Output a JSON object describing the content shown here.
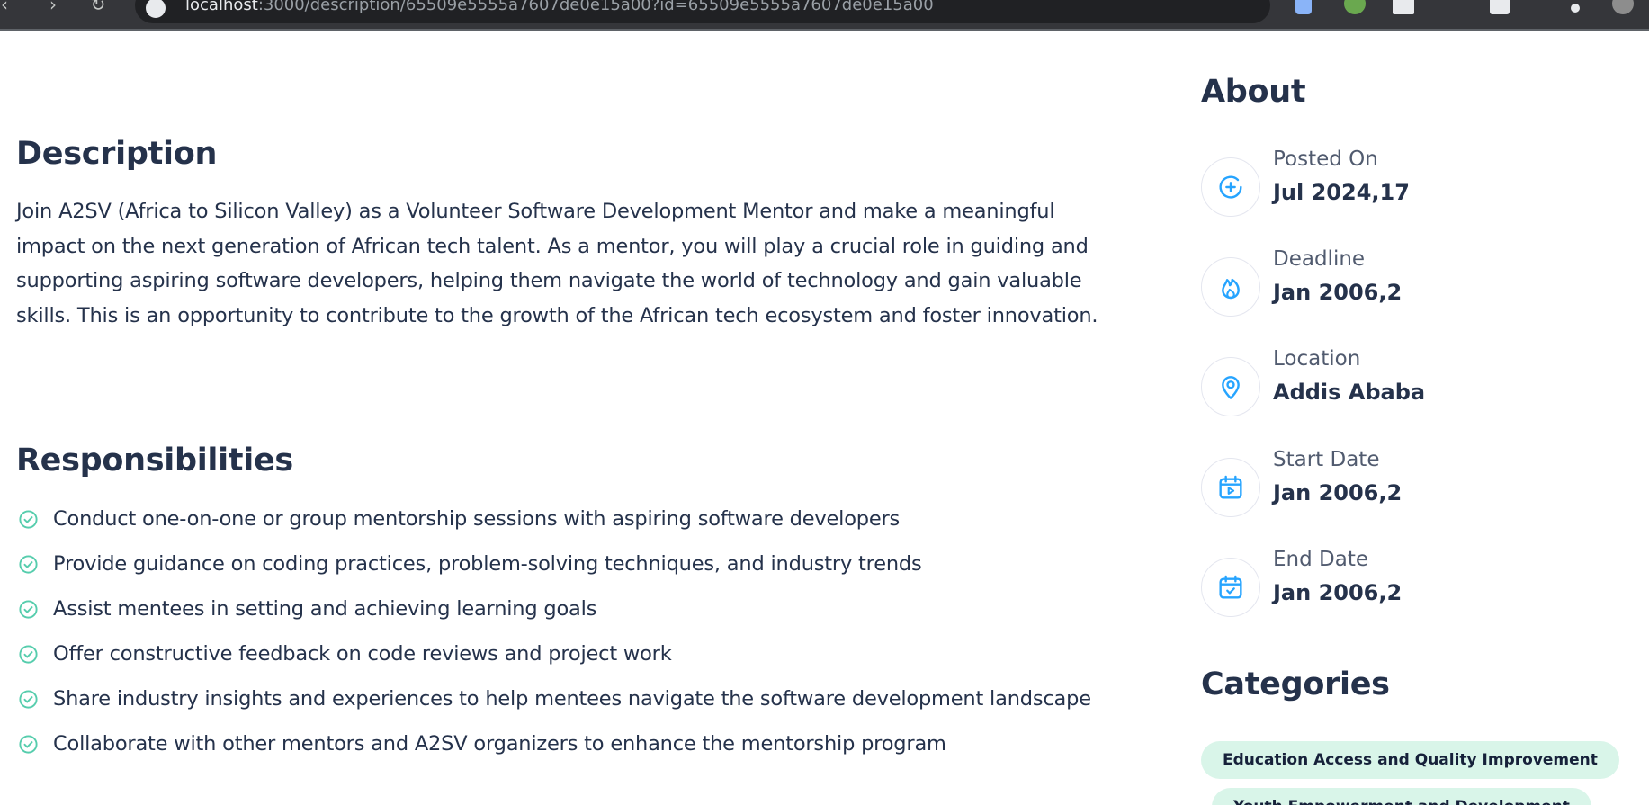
{
  "browser": {
    "url_host": "localhost",
    "url_rest": ":3000/description/65509e5555a7607de0e15a00?id=65509e5555a7607de0e15a00"
  },
  "description": {
    "title": "Description",
    "text": "Join A2SV (Africa to Silicon Valley) as a Volunteer Software Development Mentor and make a meaningful impact on the next generation of African tech talent. As a mentor, you will play a crucial role in guiding and supporting aspiring software developers, helping them navigate the world of technology and gain valuable skills. This is an opportunity to contribute to the growth of the African tech ecosystem and foster innovation."
  },
  "responsibilities": {
    "title": "Responsibilities",
    "items": [
      "Conduct one-on-one or group mentorship sessions with aspiring software developers",
      "Provide guidance on coding practices, problem-solving techniques, and industry trends",
      "Assist mentees in setting and achieving learning goals",
      "Offer constructive feedback on code reviews and project work",
      "Share industry insights and experiences to help mentees navigate the software development landscape",
      "Collaborate with other mentors and A2SV organizers to enhance the mentorship program"
    ]
  },
  "about": {
    "title": "About",
    "items": [
      {
        "label": "Posted On",
        "value": "Jul 2024,17",
        "icon": "plus-circle-icon"
      },
      {
        "label": "Deadline",
        "value": "Jan 2006,2",
        "icon": "fire-icon"
      },
      {
        "label": "Location",
        "value": "Addis Ababa",
        "icon": "map-pin-icon"
      },
      {
        "label": "Start Date",
        "value": "Jan 2006,2",
        "icon": "calendar-play-icon"
      },
      {
        "label": "End Date",
        "value": "Jan 2006,2",
        "icon": "calendar-check-icon"
      }
    ]
  },
  "categories": {
    "title": "Categories",
    "items": [
      "Education Access and Quality Improvement",
      "Youth Empowerment and Development"
    ]
  },
  "colors": {
    "heading": "#25324B",
    "accent_blue": "#26A4FF",
    "check_green": "#56CDAD",
    "tag_bg": "#d9f5e9"
  }
}
